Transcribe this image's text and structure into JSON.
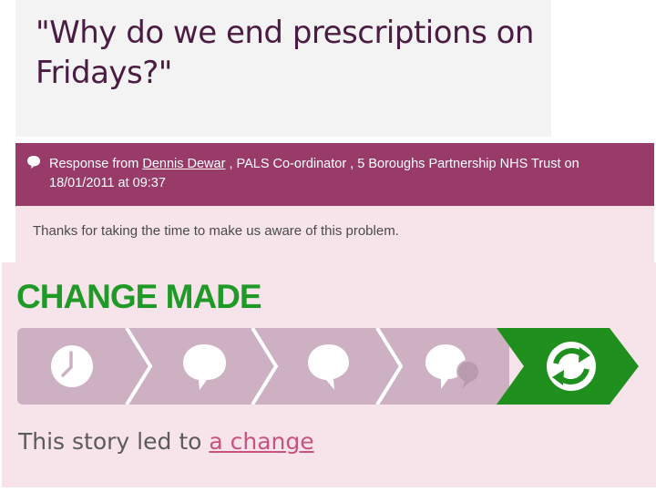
{
  "story": {
    "title": "\"Why do we end prescriptions on Fridays?\""
  },
  "response": {
    "prefix": "Response from ",
    "author": "Dennis Dewar",
    "sep1": " , ",
    "role": "PALS Co-ordinator",
    "sep2": " , ",
    "organisation": "5 Boroughs Partnership NHS Trust",
    "on_text": " on",
    "date": "18/01/2011 at 09:37",
    "message": "Thanks for taking the time to make us aware of this problem."
  },
  "progress": {
    "heading": "CHANGE MADE",
    "steps": [
      {
        "icon": "clock-icon",
        "state": "done"
      },
      {
        "icon": "speech-bubble-icon",
        "state": "done"
      },
      {
        "icon": "reply-bubble-icon",
        "state": "done"
      },
      {
        "icon": "conversation-icon",
        "state": "done"
      },
      {
        "icon": "refresh-icon",
        "state": "current"
      }
    ],
    "colors": {
      "inactive": "#cdb0c2",
      "active": "#1f8f1d",
      "arrow_edge": "#ffffff",
      "icon": "#ffffff"
    },
    "outcome_prefix": "This story led to ",
    "outcome_link": "a change"
  }
}
